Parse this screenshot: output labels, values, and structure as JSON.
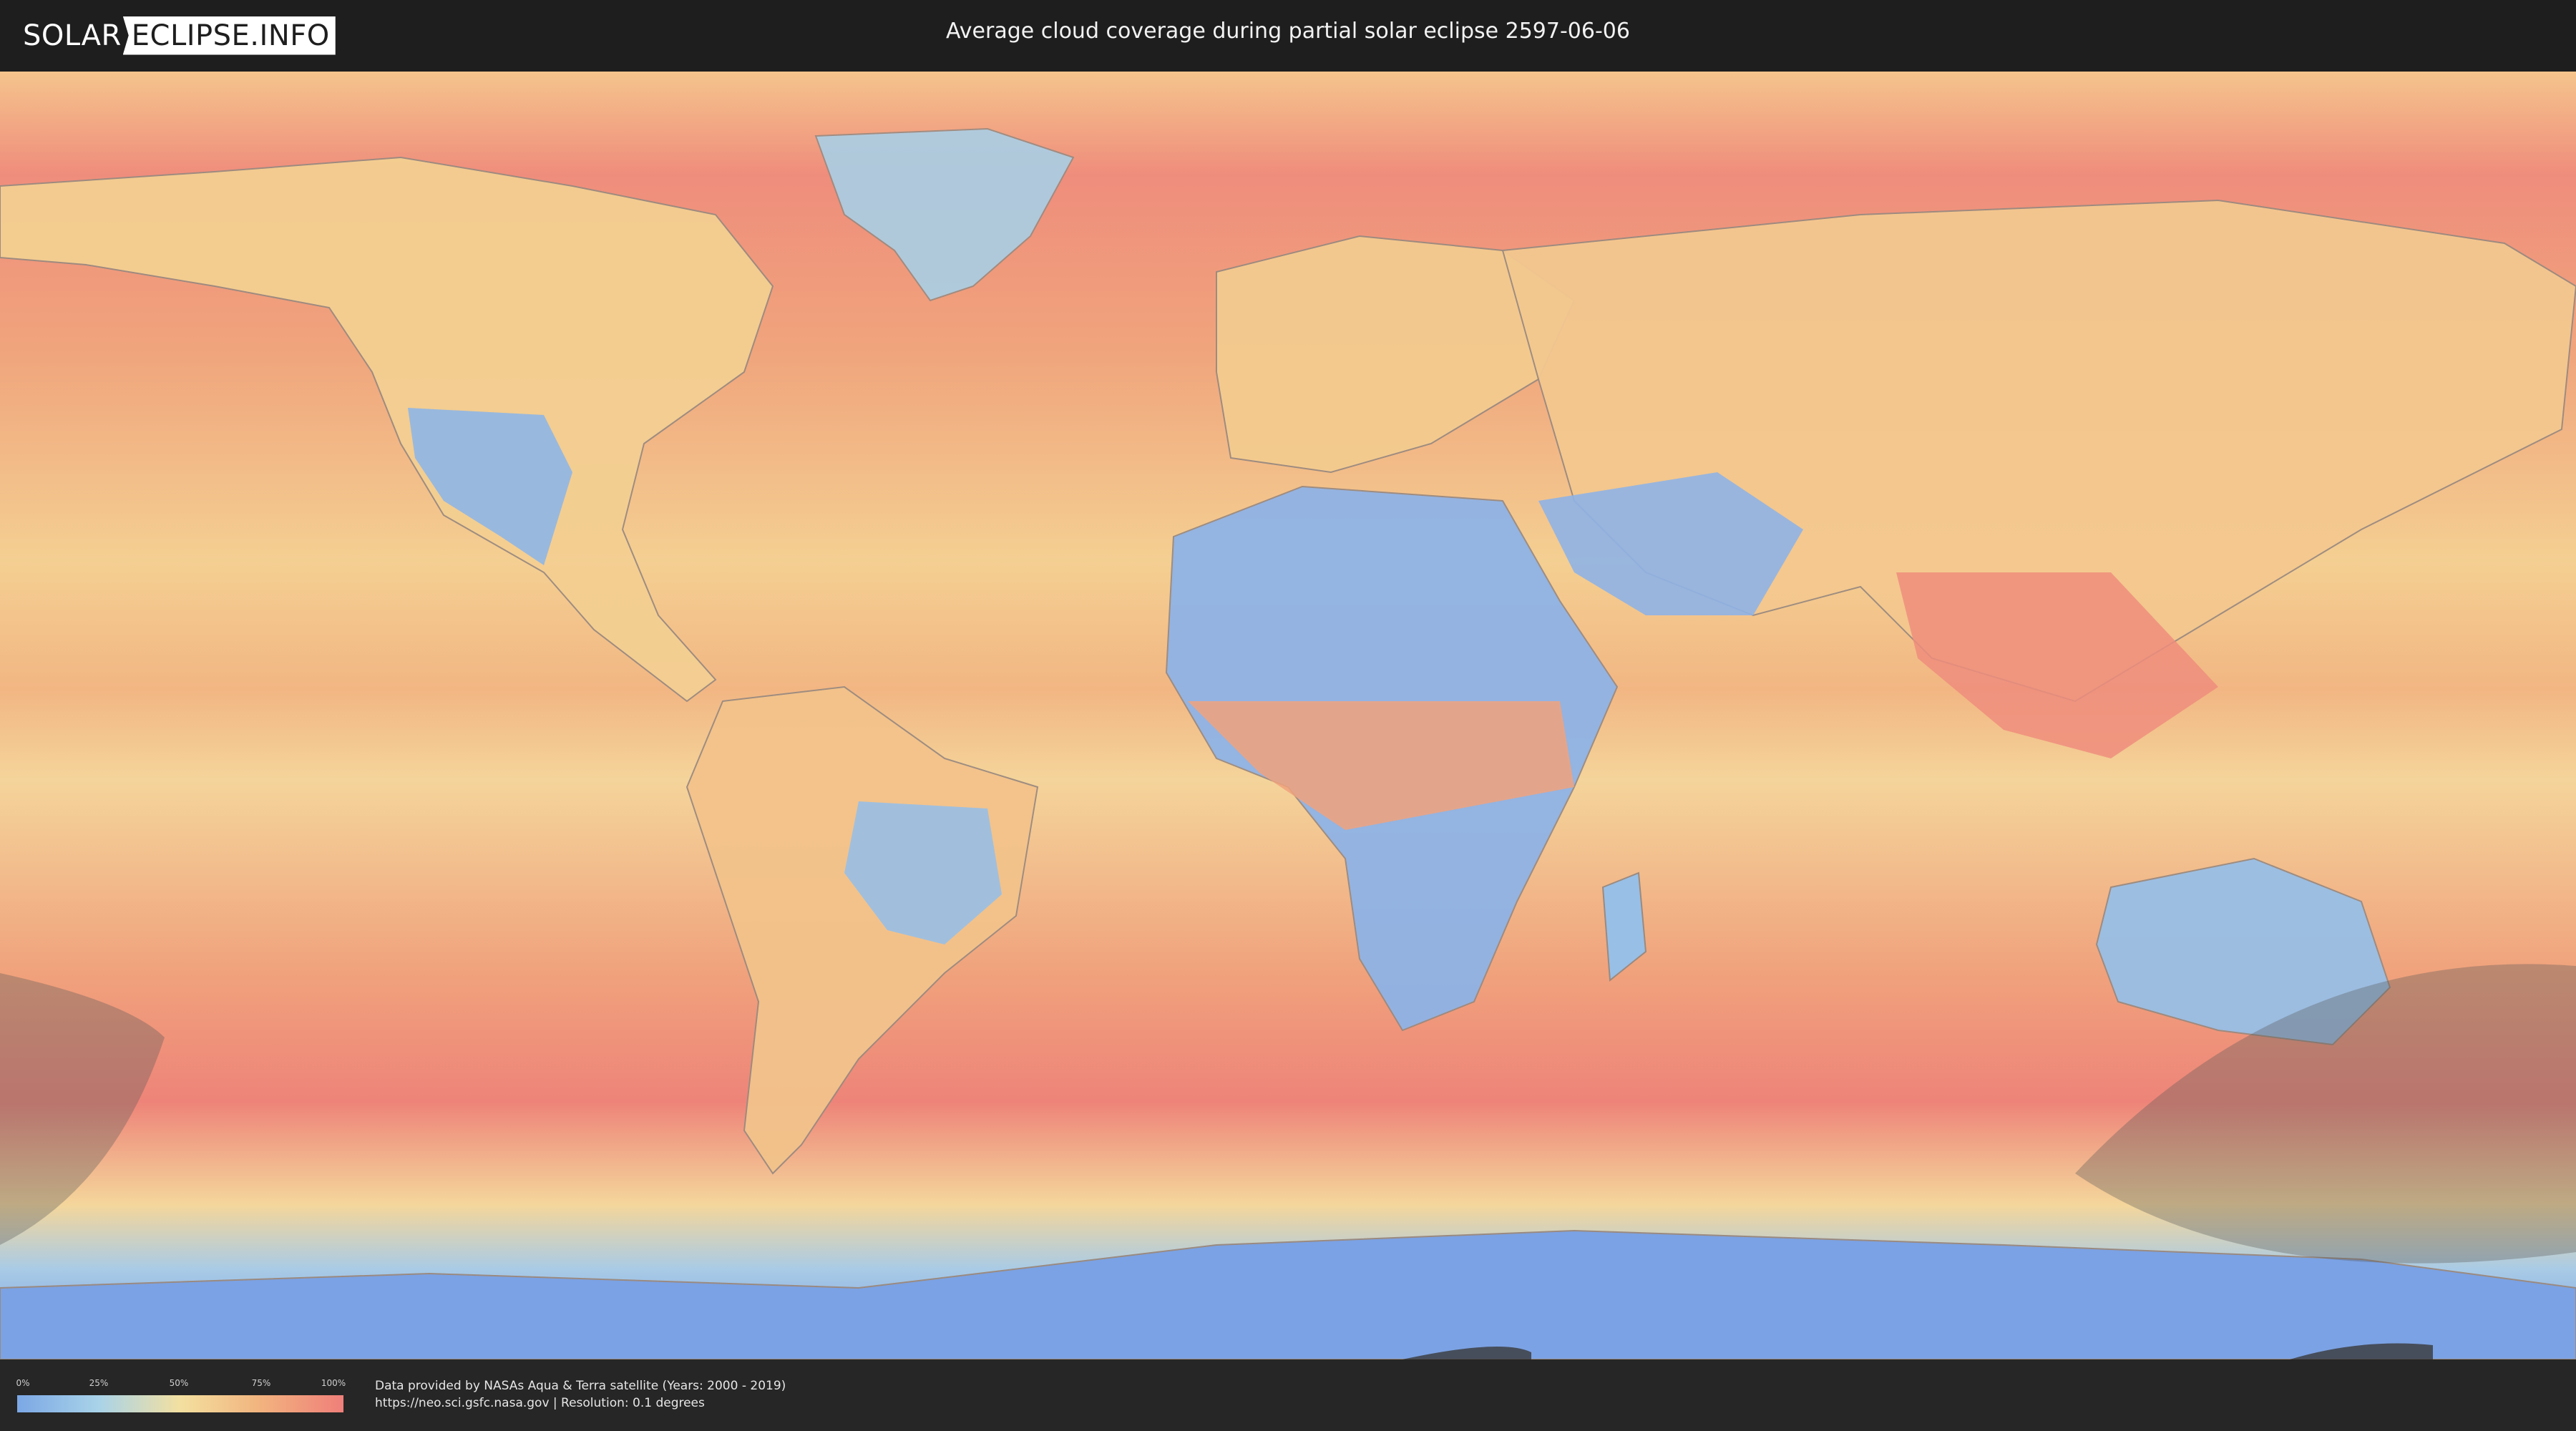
{
  "header": {
    "logo_solar": "SOLAR",
    "logo_eclipse": "ECLIPSE.INFO",
    "title": "Average cloud coverage during partial solar eclipse 2597-06-06"
  },
  "legend": {
    "ticks": [
      "0%",
      "25%",
      "50%",
      "75%",
      "100%"
    ],
    "colors": [
      "#7ba7e6",
      "#a9d3e8",
      "#f3e0a0",
      "#f2b27e",
      "#ef7f7a"
    ]
  },
  "footer": {
    "credit_line1": "Data provided by NASAs Aqua & Terra satellite (Years: 2000 - 2019)",
    "credit_line2": "https://neo.sci.gsfc.nasa.gov | Resolution: 0.1 degrees"
  },
  "map": {
    "ocean_color": "#f3a77e",
    "land_clear_color": "#86afe6",
    "shadow_color": "#5a5a5a"
  }
}
